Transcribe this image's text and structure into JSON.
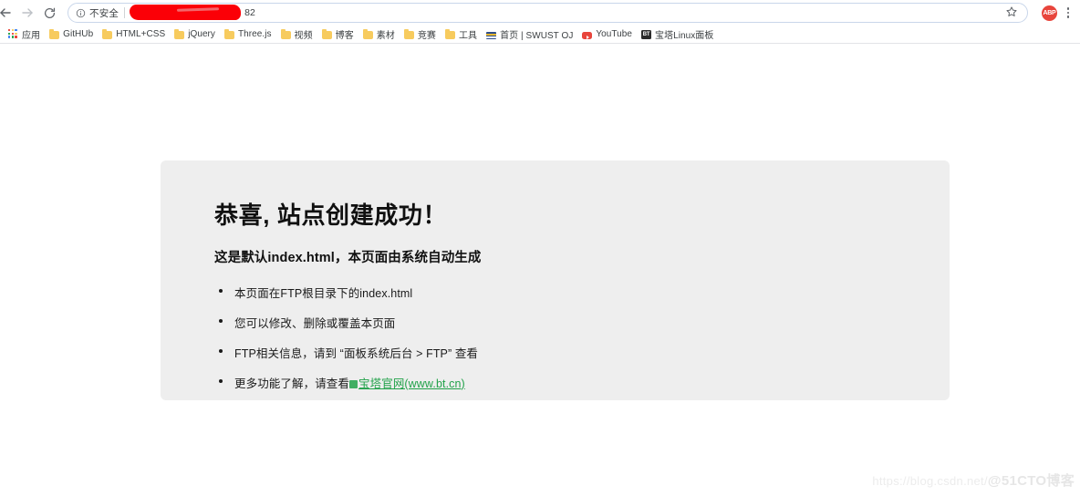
{
  "browser": {
    "toolbar": {
      "back_label": "Back",
      "forward_label": "Forward",
      "reload_label": "Reload",
      "security_label": "不安全",
      "url_visible_text": "82",
      "url_redacted": true,
      "bookmark_star_label": "Bookmark this tab",
      "profile_label": "ABP",
      "menu_label": "Customize and control"
    },
    "bookmarks": [
      {
        "label": "应用",
        "icon": "apps-grid-icon"
      },
      {
        "label": "GitHUb",
        "icon": "folder-icon"
      },
      {
        "label": "HTML+CSS",
        "icon": "folder-icon"
      },
      {
        "label": "jQuery",
        "icon": "folder-icon"
      },
      {
        "label": "Three.js",
        "icon": "folder-icon"
      },
      {
        "label": "视频",
        "icon": "folder-icon"
      },
      {
        "label": "博客",
        "icon": "folder-icon"
      },
      {
        "label": "素材",
        "icon": "folder-icon"
      },
      {
        "label": "竞赛",
        "icon": "folder-icon"
      },
      {
        "label": "工具",
        "icon": "folder-icon"
      },
      {
        "label": "首页 | SWUST OJ",
        "icon": "swust-icon"
      },
      {
        "label": "YouTube",
        "icon": "youtube-icon"
      },
      {
        "label": "宝塔Linux面板",
        "icon": "bt-panel-icon"
      }
    ]
  },
  "page": {
    "title": "恭喜, 站点创建成功！",
    "subtitle": "这是默认index.html，本页面由系统自动生成",
    "items": [
      {
        "text": "本页面在FTP根目录下的index.html"
      },
      {
        "text": "您可以修改、删除或覆盖本页面"
      },
      {
        "text": "FTP相关信息，请到 “面板系统后台 > FTP”  查看"
      }
    ],
    "last_item_prefix": "更多功能了解，请查看",
    "last_item_link": "宝塔官网(www.bt.cn)",
    "link_color": "#22a24a",
    "card_bg": "#eeeeee"
  },
  "watermark": {
    "prefix": "https://blog.csdn.net/",
    "suffix": "@51CTO博客"
  }
}
